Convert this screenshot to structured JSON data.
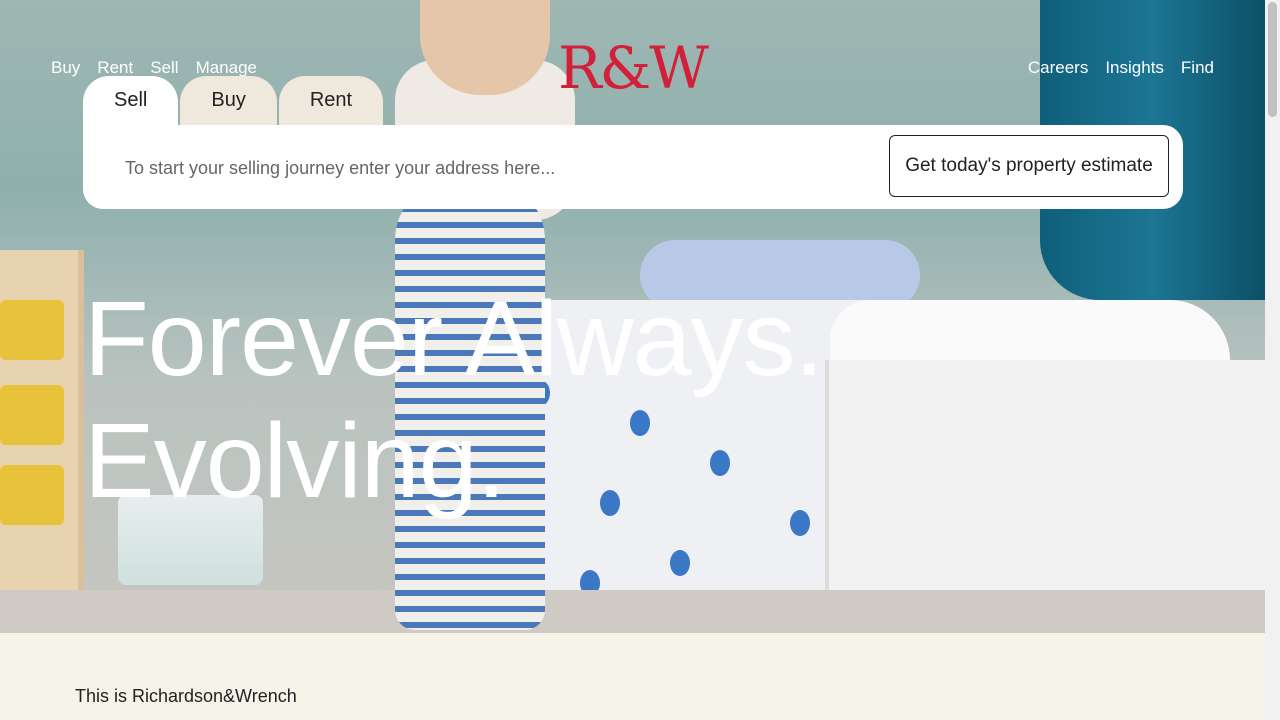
{
  "nav": {
    "left": [
      "Buy",
      "Rent",
      "Sell",
      "Manage"
    ],
    "right": [
      "Careers",
      "Insights",
      "Find"
    ]
  },
  "logo": {
    "text": "R&W",
    "color": "#d3203a"
  },
  "search": {
    "tabs": [
      "Sell",
      "Buy",
      "Rent"
    ],
    "active_tab": "Sell",
    "placeholder": "To start your selling journey enter your address here...",
    "button_label": "Get today's property estimate"
  },
  "hero": {
    "line1": "Forever Always.",
    "line2": "Evolving."
  },
  "intro": {
    "text": "This is Richardson&Wrench"
  },
  "colors": {
    "section_bg": "#f6f3e9",
    "tab_inactive": "#efe9dd"
  }
}
